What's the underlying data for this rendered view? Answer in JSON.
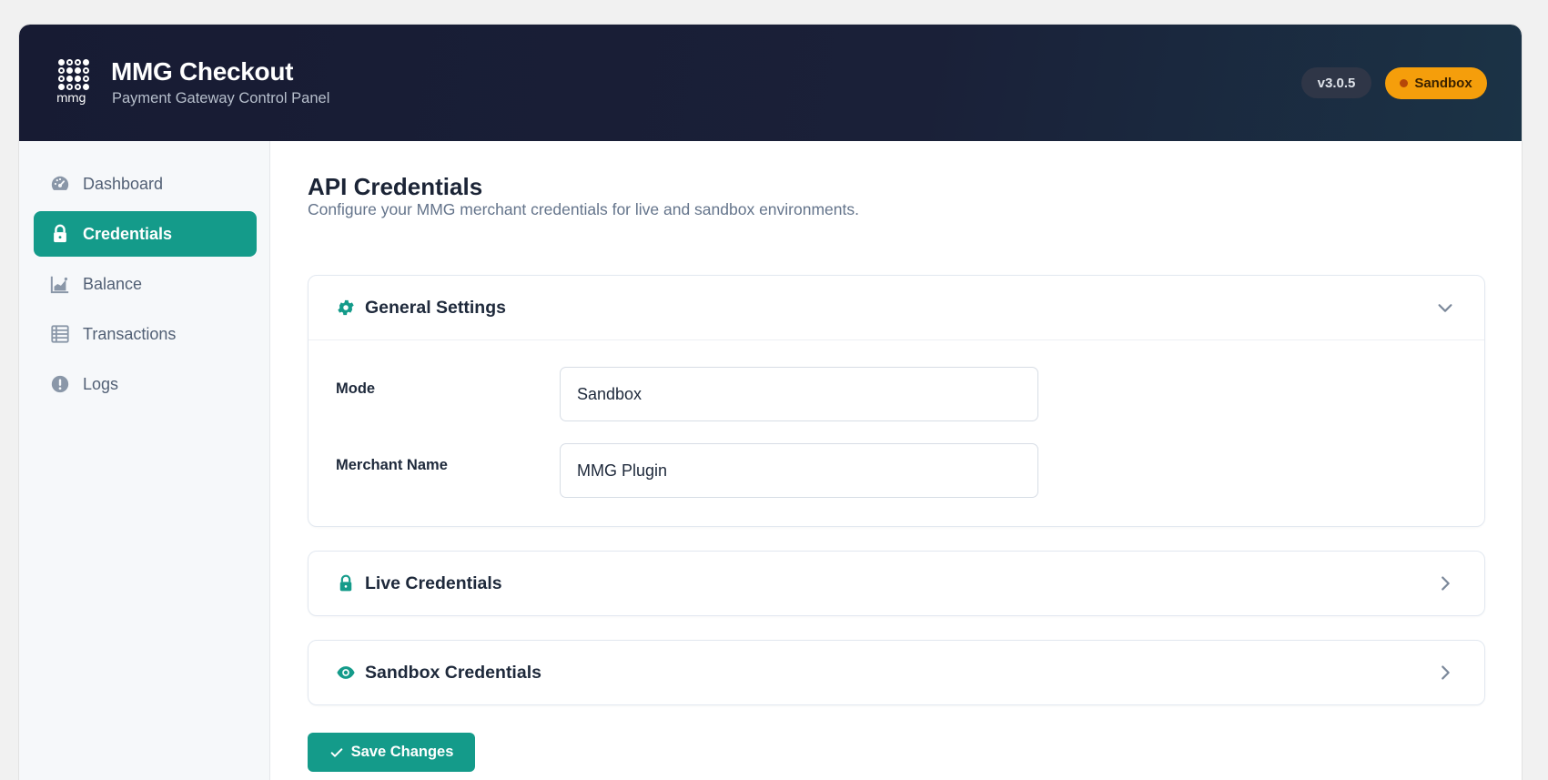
{
  "header": {
    "logo_text": "mmg",
    "title": "MMG Checkout",
    "subtitle": "Payment Gateway Control Panel",
    "version": "v3.0.5",
    "environment": "Sandbox"
  },
  "sidebar": {
    "items": [
      {
        "label": "Dashboard",
        "icon": "dashboard-gauge-icon",
        "active": false
      },
      {
        "label": "Credentials",
        "icon": "lock-icon",
        "active": true
      },
      {
        "label": "Balance",
        "icon": "chart-area-icon",
        "active": false
      },
      {
        "label": "Transactions",
        "icon": "table-list-icon",
        "active": false
      },
      {
        "label": "Logs",
        "icon": "exclamation-circle-icon",
        "active": false
      }
    ]
  },
  "main": {
    "title": "API Credentials",
    "description": "Configure your MMG merchant credentials for live and sandbox environments.",
    "sections": [
      {
        "title": "General Settings",
        "icon": "gear-icon",
        "expanded": true,
        "fields": [
          {
            "label": "Mode",
            "value": "Sandbox"
          },
          {
            "label": "Merchant Name",
            "value": "MMG Plugin"
          }
        ]
      },
      {
        "title": "Live Credentials",
        "icon": "lock-icon",
        "expanded": false
      },
      {
        "title": "Sandbox Credentials",
        "icon": "eye-icon",
        "expanded": false
      }
    ],
    "save_label": "Save Changes"
  },
  "colors": {
    "accent": "#149b8a",
    "header_bg": "#171b33",
    "sandbox_badge": "#f59e0b"
  }
}
